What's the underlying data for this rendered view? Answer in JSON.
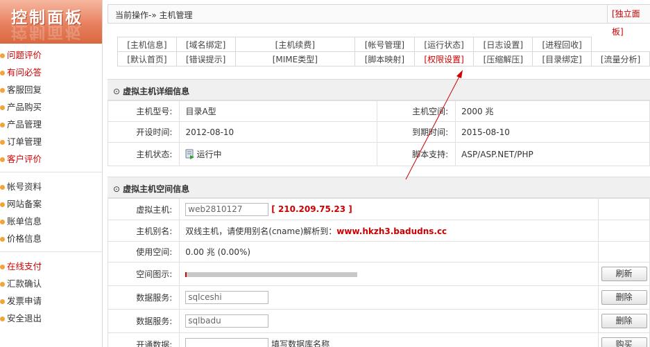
{
  "sidebar": {
    "logo": "控制面板",
    "group1": [
      {
        "label": "问题评价",
        "red": true
      },
      {
        "label": "有问必答",
        "red": true
      },
      {
        "label": "客服回复",
        "red": false
      },
      {
        "label": "产品购买",
        "red": false
      },
      {
        "label": "产品管理",
        "red": false
      },
      {
        "label": "订单管理",
        "red": false
      },
      {
        "label": "客户评价",
        "red": true
      }
    ],
    "group2": [
      {
        "label": "帐号资料",
        "red": false
      },
      {
        "label": "网站备案",
        "red": false
      },
      {
        "label": "账单信息",
        "red": false
      },
      {
        "label": "价格信息",
        "red": false
      }
    ],
    "group3": [
      {
        "label": "在线支付",
        "red": true
      },
      {
        "label": "汇款确认",
        "red": false
      },
      {
        "label": "发票申请",
        "red": false
      },
      {
        "label": "安全退出",
        "red": false
      }
    ]
  },
  "header": {
    "breadcrumb": "当前操作-» 主机管理",
    "independent_panel": "[独立面板]"
  },
  "nav_row1": [
    "[主机信息]",
    "[域名绑定]",
    "[主机续费]",
    "[帐号管理]",
    "[运行状态]",
    "[日志设置]",
    "[进程回收]"
  ],
  "nav_row2": [
    "[默认首页]",
    "[错误提示]",
    "[MIME类型]",
    "[脚本映射]",
    "[权限设置]",
    "[压缩解压]",
    "[目录绑定]",
    "[流量分析]"
  ],
  "details": {
    "title": "虚拟主机详细信息",
    "model_label": "主机型号:",
    "model_value": "目录A型",
    "space_label": "主机空间:",
    "space_value": "2000 兆",
    "open_label": "开设时间:",
    "open_value": "2012-08-10",
    "expire_label": "到期时间:",
    "expire_value": "2015-08-10",
    "status_label": "主机状态:",
    "status_value": "运行中",
    "script_label": "脚本支持:",
    "script_value": "ASP/ASP.NET/PHP"
  },
  "space": {
    "title": "虚拟主机空间信息",
    "host_label": "虚拟主机:",
    "host_value": "web2810127",
    "ip_text": "[ 210.209.75.23 ]",
    "alias_label": "主机别名:",
    "alias_text": "双线主机，请使用别名(cname)解析到：",
    "alias_cname": "www.hkzh3.badudns.cc",
    "used_label": "使用空间:",
    "used_value": "0.00 兆 (0.00%)",
    "usage_fraction": 0.0,
    "diagram_label": "空间图示:",
    "refresh_btn": "刷新",
    "db1_label": "数据服务:",
    "db1_value": "sqlceshi",
    "db1_btn": "删除",
    "db2_label": "数据服务:",
    "db2_value": "sqlbadu",
    "db2_btn": "删除",
    "open_db_label": "开通数据:",
    "open_db_hint": "填写数据库名称",
    "buy_btn": "购买"
  }
}
